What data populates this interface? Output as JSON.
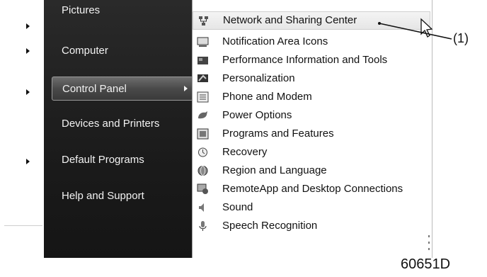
{
  "start_menu": {
    "items": [
      {
        "label": "Pictures"
      },
      {
        "label": "Computer"
      },
      {
        "label": "Control Panel"
      },
      {
        "label": "Devices and Printers"
      },
      {
        "label": "Default Programs"
      },
      {
        "label": "Help and Support"
      }
    ]
  },
  "control_panel_menu": {
    "items": [
      {
        "label": "Network and Sharing Center",
        "icon": "network-icon"
      },
      {
        "label": "Notification Area Icons",
        "icon": "notification-icon"
      },
      {
        "label": "Performance Information and Tools",
        "icon": "performance-icon"
      },
      {
        "label": "Personalization",
        "icon": "personalization-icon"
      },
      {
        "label": "Phone and Modem",
        "icon": "phone-icon"
      },
      {
        "label": "Power Options",
        "icon": "power-icon"
      },
      {
        "label": "Programs and Features",
        "icon": "programs-icon"
      },
      {
        "label": "Recovery",
        "icon": "recovery-icon"
      },
      {
        "label": "Region and Language",
        "icon": "globe-icon"
      },
      {
        "label": "RemoteApp and Desktop Connections",
        "icon": "remoteapp-icon"
      },
      {
        "label": "Sound",
        "icon": "speaker-icon"
      },
      {
        "label": "Speech Recognition",
        "icon": "microphone-icon"
      }
    ]
  },
  "callout": {
    "label": "(1)"
  },
  "figure": {
    "id": "60651D"
  }
}
